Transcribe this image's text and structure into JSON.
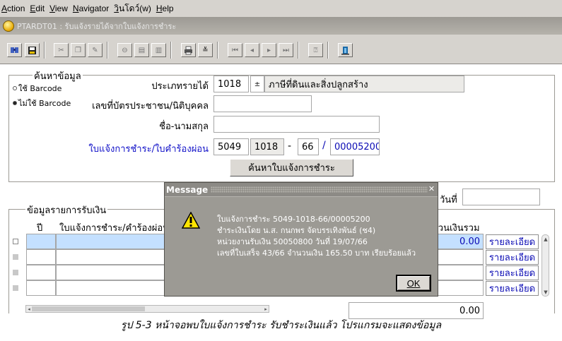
{
  "menu": {
    "items": [
      "Action",
      "Edit",
      "View",
      "Navigator",
      "วินโดว์(w)",
      "Help"
    ]
  },
  "form": {
    "title": "PTARDT01 : รับแจ้งรายได้จากใบแจ้งการชำระ"
  },
  "search_section": {
    "title": "ค้นหาข้อมูล",
    "radio_barcode": "ใช้ Barcode",
    "radio_no_barcode": "ไม่ใช้ Barcode",
    "selected_radio": "no_barcode",
    "income_type_label": "ประเภทรายได้",
    "income_type_code": "1018",
    "income_type_name": "ภาษีที่ดินและสิ่งปลูกสร้าง",
    "id_card_label": "เลขที่บัตรประชาชน/นิติบุคคล",
    "id_card_value": "",
    "name_label": "ชื่อ-นามสกุล",
    "name_value": "",
    "notice_label": "ใบแจ้งการชำระ/ใบคำร้องผ่อน",
    "notice_part1": "5049",
    "notice_part2": "1018",
    "notice_sep1": "-",
    "notice_part3": "66",
    "notice_sep2": "/",
    "notice_part4": "00005200",
    "search_button": "ค้นหาใบแจ้งการชำระ"
  },
  "date_label": "วันที่",
  "date_value": "",
  "receipt_section": {
    "title": "ข้อมูลรายการรับเงิน",
    "col_year": "ปี",
    "col_notice": "ใบแจ้งการชำระ/คำร้องผ่อน",
    "col_amount": "จำนวนเงินรวม",
    "rows": [
      {
        "amount": "0.00",
        "detail": "รายละเอียด"
      },
      {
        "amount": "",
        "detail": "รายละเอียด"
      },
      {
        "amount": "",
        "detail": "รายละเอียด"
      },
      {
        "amount": "",
        "detail": "รายละเอียด"
      }
    ],
    "total": "0.00"
  },
  "dialog": {
    "title": "Message",
    "lines": [
      "ใบแจ้งการชำระ 5049-1018-66/00005200",
      "ชำระเงินโดย น.ส. กนกพร จัดบรรเทิงพันธ์ (ช4)",
      "หน่วยงานรับเงิน 50050800 วันที่ 19/07/66",
      "เลขที่ใบเสร็จ 43/66 จำนวนเงิน 165.50 บาท เรียบร้อยแล้ว"
    ],
    "ok_label": "OK"
  },
  "caption": "รูป 5-3 หน้าจอพบใบแจ้งการชำระ รับชำระเงินแล้ว โปรแกรมจะแสดงข้อมูล",
  "icons": [
    "form-icon",
    "enter-query-icon",
    "save-icon",
    "cut-icon",
    "copy-icon",
    "paste-icon",
    "clear-icon",
    "insert-record-icon",
    "delete-record-icon",
    "print-icon",
    "edit-icon",
    "first-record-icon",
    "prev-record-icon",
    "next-record-icon",
    "last-record-icon",
    "help-icon",
    "exit-icon",
    "warning-icon"
  ]
}
